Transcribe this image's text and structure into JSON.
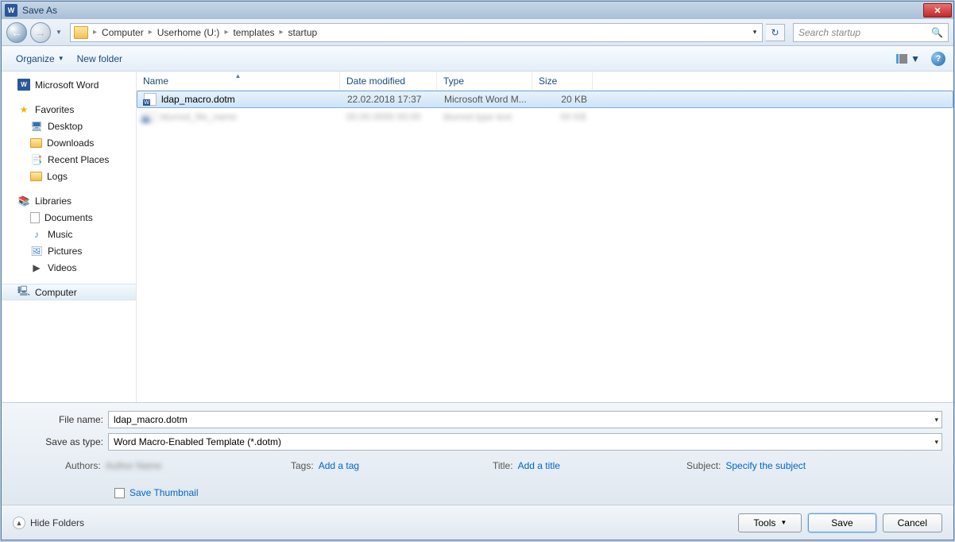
{
  "titlebar": {
    "title": "Save As"
  },
  "breadcrumb": {
    "root": "Computer",
    "items": [
      "Userhome (U:)",
      "templates",
      "startup"
    ]
  },
  "search": {
    "placeholder": "Search startup"
  },
  "toolbar": {
    "organize": "Organize",
    "newfolder": "New folder"
  },
  "sidebar": {
    "word": "Microsoft Word",
    "favorites": "Favorites",
    "fav_items": [
      "Desktop",
      "Downloads",
      "Recent Places",
      "Logs"
    ],
    "libraries": "Libraries",
    "lib_items": [
      "Documents",
      "Music",
      "Pictures",
      "Videos"
    ],
    "computer": "Computer"
  },
  "columns": {
    "name": "Name",
    "date": "Date modified",
    "type": "Type",
    "size": "Size"
  },
  "files": [
    {
      "name": "ldap_macro.dotm",
      "date": "22.02.2018 17:37",
      "type": "Microsoft Word M...",
      "size": "20 KB",
      "selected": true
    },
    {
      "name": "blurred_file_name",
      "date": "00.00.0000 00:00",
      "type": "blurred type text",
      "size": "00 KB",
      "blurred": true
    }
  ],
  "form": {
    "filename_label": "File name:",
    "filename_value": "ldap_macro.dotm",
    "saveastype_label": "Save as type:",
    "saveastype_value": "Word Macro-Enabled Template (*.dotm)",
    "authors_label": "Authors:",
    "authors_value": "Author Name",
    "tags_label": "Tags:",
    "tags_value": "Add a tag",
    "title_label": "Title:",
    "title_value": "Add a title",
    "subject_label": "Subject:",
    "subject_value": "Specify the subject",
    "save_thumbnail": "Save Thumbnail"
  },
  "footer": {
    "hide": "Hide Folders",
    "tools": "Tools",
    "save": "Save",
    "cancel": "Cancel"
  }
}
